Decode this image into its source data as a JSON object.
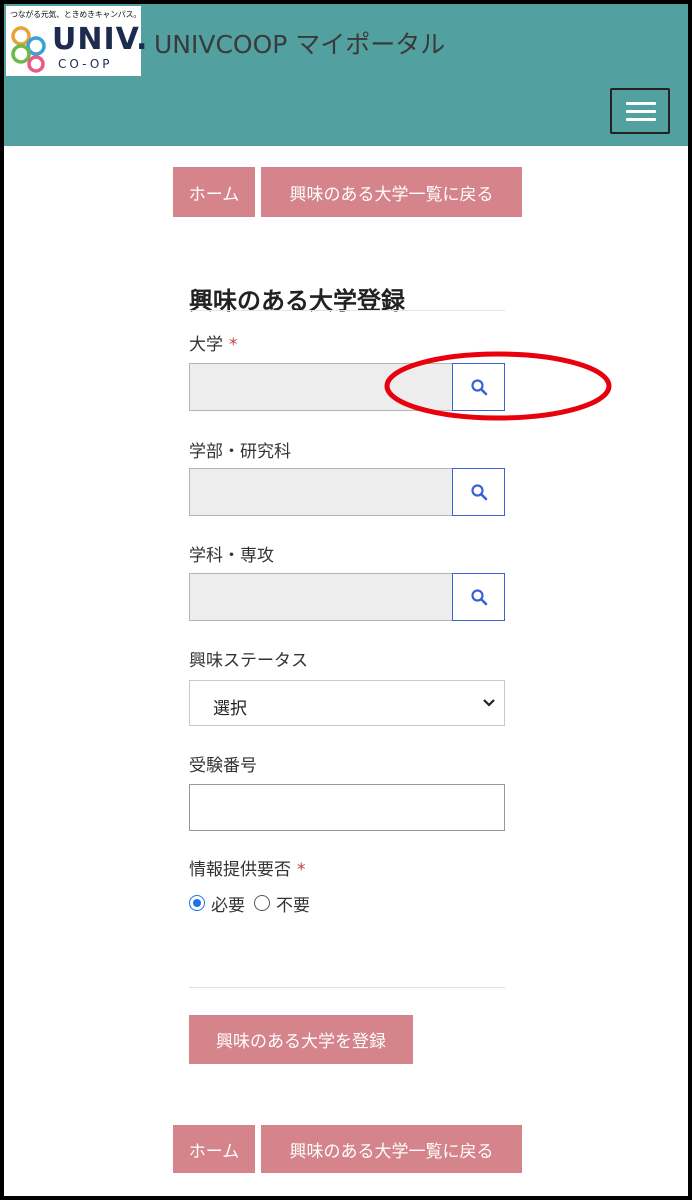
{
  "header": {
    "logo_tagline": "つながる元気、ときめきキャンパス。",
    "logo_univ": "UNIV.",
    "logo_coop": "CO-OP",
    "title": "UNIVCOOP マイポータル",
    "menu_icon": "hamburger-icon",
    "background_color": "#52a0a0"
  },
  "nav_top": {
    "home_label": "ホーム",
    "back_label": "興味のある大学一覧に戻る"
  },
  "form": {
    "title": "興味のある大学登録",
    "university_label": "大学",
    "faculty_label": "学部・研究科",
    "department_label": "学科・専攻",
    "interest_status_label": "興味ステータス",
    "interest_status_selected": "選択",
    "exam_number_label": "受験番号",
    "exam_number_value": "",
    "info_provision_label": "情報提供要否",
    "required_mark": "*",
    "radio_needed": "必要",
    "radio_not_needed": "不要",
    "radio_selected": "必要",
    "search_icon": "search-icon",
    "submit_label": "興味のある大学を登録"
  },
  "nav_bottom": {
    "home_label": "ホーム",
    "back_label": "興味のある大学一覧に戻る"
  },
  "colors": {
    "button": "#d4848a",
    "accent": "#3a62d6",
    "highlight": "#e8000c"
  }
}
